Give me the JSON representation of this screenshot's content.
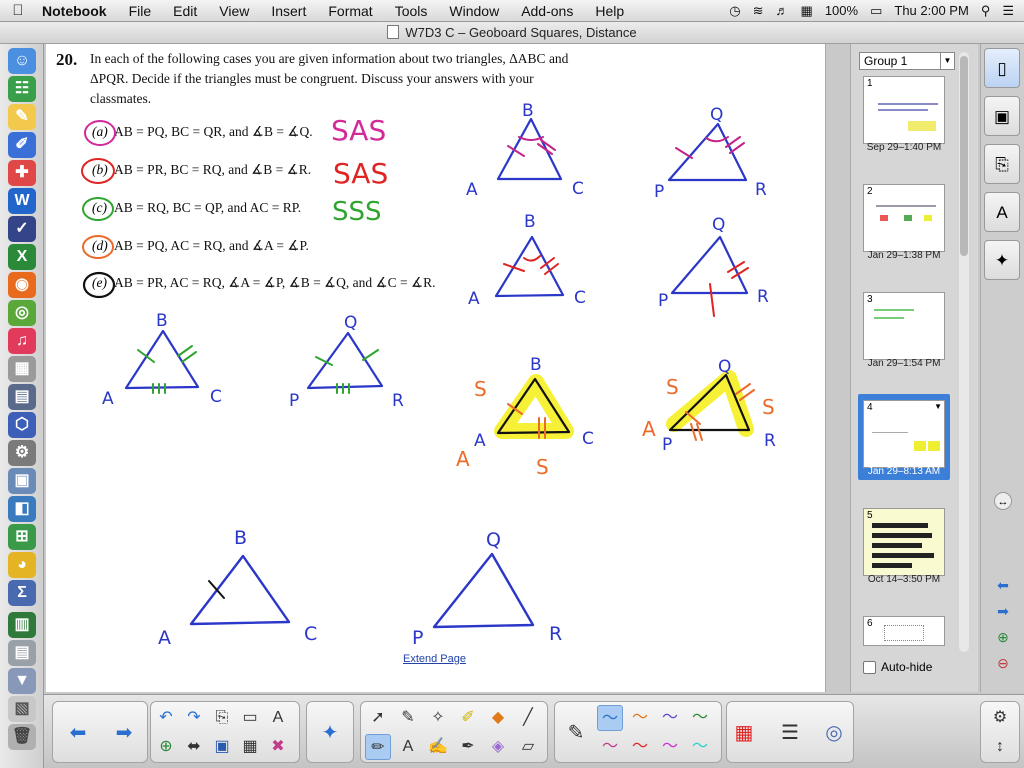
{
  "menubar": {
    "apple": "",
    "app_name": "Notebook",
    "menus": [
      "File",
      "Edit",
      "View",
      "Insert",
      "Format",
      "Tools",
      "Window",
      "Add-ons",
      "Help"
    ],
    "battery": "100%",
    "clock": "Thu 2:00 PM"
  },
  "window": {
    "title": "W7D3 C – Geoboard Squares, Distance"
  },
  "page": {
    "question_number": "20.",
    "question_text": "In each of the following cases you are given information about two triangles, ΔABC and ΔPQR. Decide if the triangles must be congruent. Discuss your answers with your classmates.",
    "cases": [
      {
        "letter": "(a)",
        "text": "AB = PQ, BC = QR, and ∡B = ∡Q.",
        "handwritten": "SAS",
        "ink_color": "#d32a9a"
      },
      {
        "letter": "(b)",
        "text": "AB = PR, BC = RQ, and ∡B = ∡R.",
        "handwritten": "SAS",
        "ink_color": "#e02424"
      },
      {
        "letter": "(c)",
        "text": "AB = RQ, BC = QP, and AC = RP.",
        "handwritten": "SSS",
        "ink_color": "#2fa52f"
      },
      {
        "letter": "(d)",
        "text": "AB = PQ, AC = RQ, and ∡A = ∡P.",
        "handwritten": "",
        "ink_color": "#ec6a2a"
      },
      {
        "letter": "(e)",
        "text": "AB = PR, AC = RQ, ∡A = ∡P, ∡B = ∡Q, and ∡C = ∡R.",
        "handwritten": "",
        "ink_color": "#111111"
      }
    ],
    "vertex_labels": {
      "abc": [
        "A",
        "B",
        "C"
      ],
      "pqr": [
        "P",
        "Q",
        "R"
      ]
    },
    "side_marks": [
      "S",
      "S",
      "S",
      "S"
    ],
    "extend_link": "Extend Page"
  },
  "sidepanel": {
    "group_label": "Group 1",
    "thumbnails": [
      {
        "num": "1",
        "date": "Sep 29–1:40 PM",
        "selected": false
      },
      {
        "num": "2",
        "date": "Jan 29–1:38 PM",
        "selected": false
      },
      {
        "num": "3",
        "date": "Jan 29–1:54 PM",
        "selected": false
      },
      {
        "num": "4",
        "date": "Jan 29–8:13 AM",
        "selected": true
      },
      {
        "num": "5",
        "date": "Oct 14–3:50 PM",
        "selected": false
      },
      {
        "num": "6",
        "date": "",
        "selected": false
      }
    ],
    "autohide_label": "Auto-hide"
  },
  "colors": {
    "ink_blue": "#2b37c9",
    "ink_red": "#e02424",
    "ink_green": "#2fa52f",
    "ink_orange": "#ec6a2a",
    "highlight": "#f5ee14",
    "selection": "#3b7fd8"
  }
}
